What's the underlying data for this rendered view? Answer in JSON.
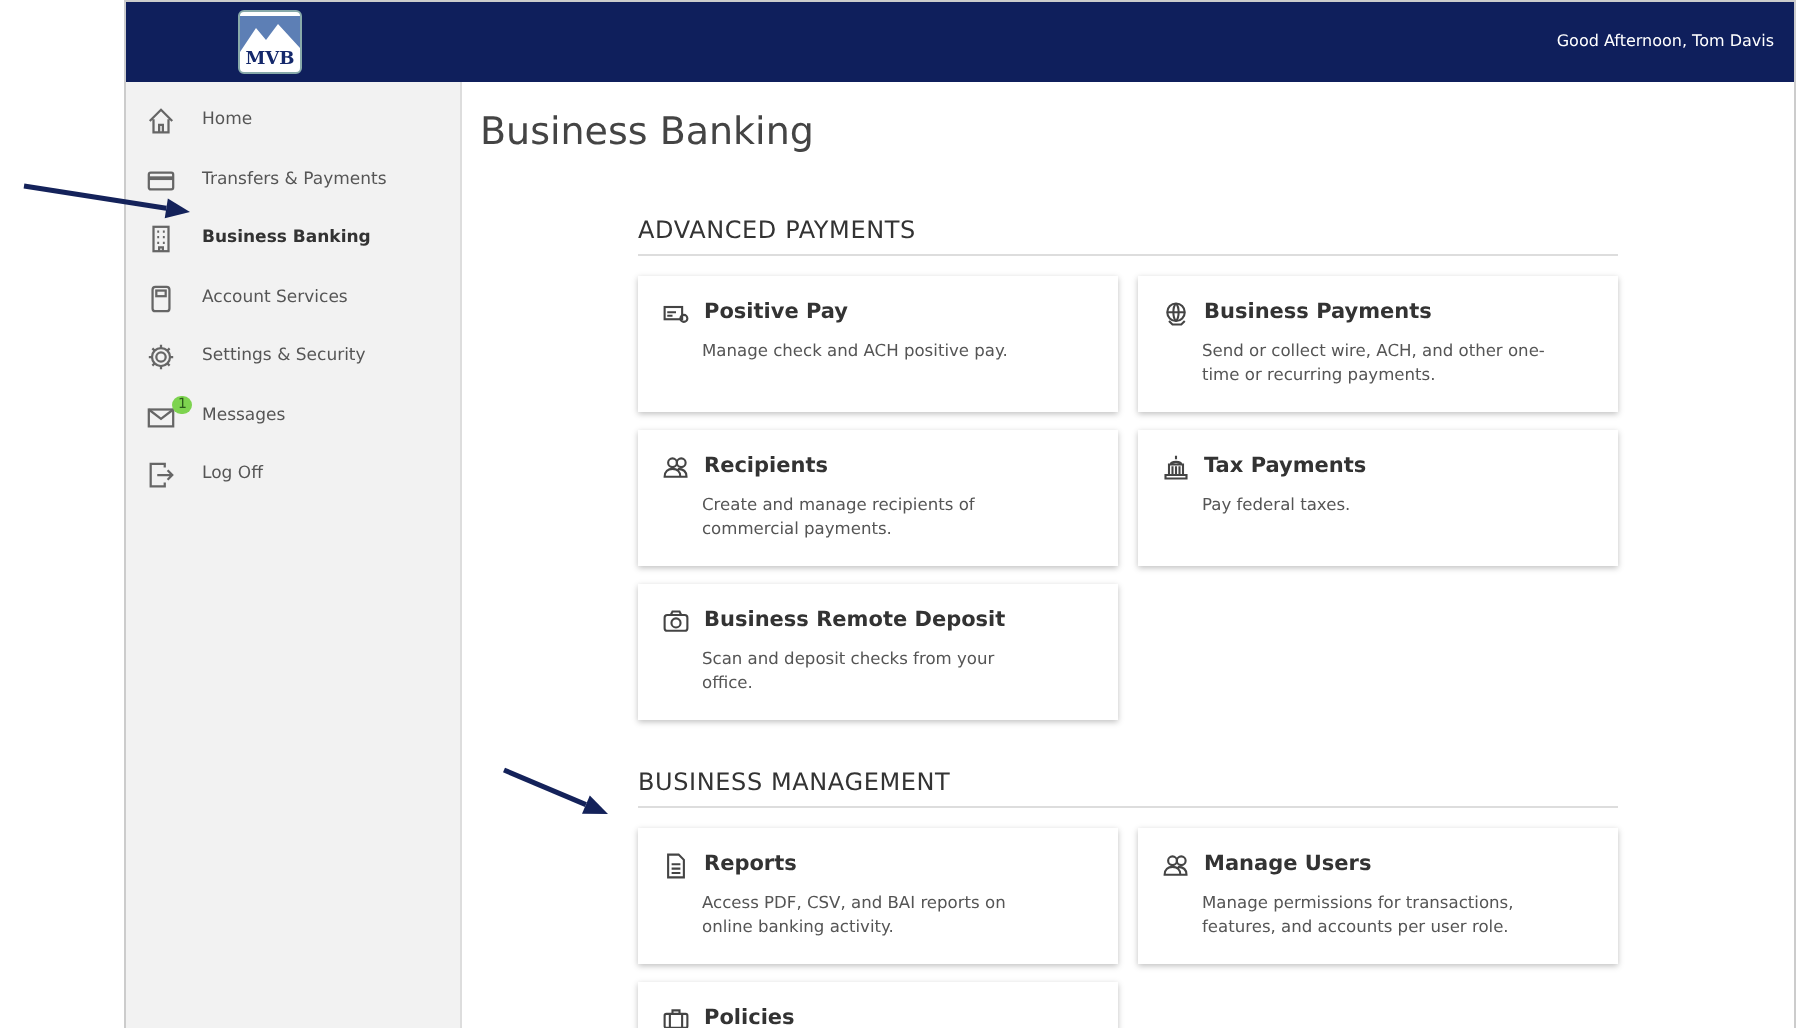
{
  "header": {
    "logo": "MVB",
    "greeting": "Good Afternoon, Tom Davis"
  },
  "sidebar": {
    "items": [
      {
        "kind": "home",
        "label": "Home",
        "selected": false
      },
      {
        "kind": "card",
        "label": "Transfers & Payments",
        "selected": false
      },
      {
        "kind": "building",
        "label": "Business Banking",
        "selected": true
      },
      {
        "kind": "calculator",
        "label": "Account Services",
        "selected": false
      },
      {
        "kind": "gear",
        "label": "Settings & Security",
        "selected": false
      },
      {
        "kind": "envelope",
        "label": "Messages",
        "selected": false,
        "badge": "1"
      },
      {
        "kind": "logout",
        "label": "Log Off",
        "selected": false
      }
    ]
  },
  "page_title": "Business Banking",
  "sections": [
    {
      "title": "ADVANCED PAYMENTS",
      "cards": [
        {
          "kind": "check",
          "title": "Positive Pay",
          "description": "Manage check and ACH positive pay."
        },
        {
          "kind": "globe",
          "title": "Business Payments",
          "description": "Send or collect wire, ACH, and other one-time or recurring payments."
        },
        {
          "kind": "people",
          "title": "Recipients",
          "description": "Create and manage recipients of commercial payments."
        },
        {
          "kind": "capitol",
          "title": "Tax Payments",
          "description": "Pay federal taxes."
        },
        {
          "kind": "camera",
          "title": "Business Remote Deposit",
          "description": "Scan and deposit checks from your office."
        }
      ]
    },
    {
      "title": "BUSINESS MANAGEMENT",
      "cards": [
        {
          "kind": "document",
          "title": "Reports",
          "description": "Access PDF, CSV, and BAI reports on online banking activity."
        },
        {
          "kind": "people",
          "title": "Manage Users",
          "description": "Manage permissions for transactions, features, and accounts per user role."
        },
        {
          "kind": "briefcase",
          "title": "Policies"
        }
      ]
    }
  ]
}
